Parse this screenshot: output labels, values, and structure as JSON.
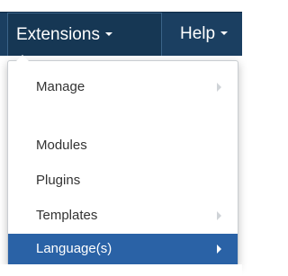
{
  "navbar": {
    "items": [
      {
        "label": "Extensions"
      },
      {
        "label": "Help"
      }
    ]
  },
  "menu": {
    "items": [
      {
        "label": "Manage"
      },
      {
        "label": "Modules"
      },
      {
        "label": "Plugins"
      },
      {
        "label": "Templates"
      },
      {
        "label": "Language(s)"
      }
    ]
  },
  "icons": {
    "caret": "caret-down-icon",
    "submenu": "chevron-right-icon"
  },
  "colors": {
    "navbar": "#1b3f61",
    "active_item": "#2a62a6",
    "menu_text": "#333333",
    "menu_bg": "#ffffff"
  }
}
